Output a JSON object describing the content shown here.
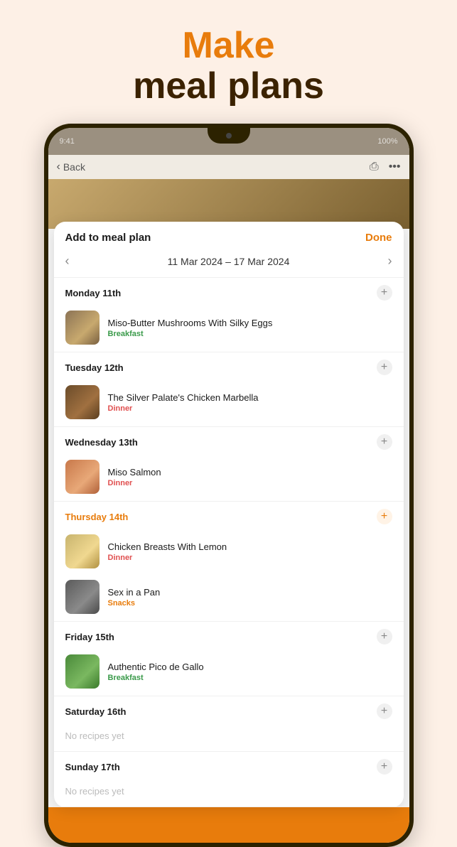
{
  "hero": {
    "make_label": "Make",
    "subtitle_label": "meal plans"
  },
  "device": {
    "top_bar_left": "9:41",
    "top_bar_right": "100%"
  },
  "browser": {
    "back_label": "Back"
  },
  "modal": {
    "title": "Add to meal plan",
    "done_label": "Done",
    "date_range": "11 Mar 2024 – 17 Mar 2024",
    "days": [
      {
        "id": "monday",
        "label": "Monday 11th",
        "highlighted": false,
        "recipes": [
          {
            "name": "Miso-Butter Mushrooms With Silky Eggs",
            "tag": "Breakfast",
            "tag_type": "breakfast",
            "thumb": "mushroom"
          }
        ]
      },
      {
        "id": "tuesday",
        "label": "Tuesday 12th",
        "highlighted": false,
        "recipes": [
          {
            "name": "The Silver Palate's Chicken Marbella",
            "tag": "Dinner",
            "tag_type": "dinner",
            "thumb": "chicken"
          }
        ]
      },
      {
        "id": "wednesday",
        "label": "Wednesday 13th",
        "highlighted": false,
        "recipes": [
          {
            "name": "Miso Salmon",
            "tag": "Dinner",
            "tag_type": "dinner",
            "thumb": "salmon"
          }
        ]
      },
      {
        "id": "thursday",
        "label": "Thursday 14th",
        "highlighted": true,
        "recipes": [
          {
            "name": "Chicken Breasts With Lemon",
            "tag": "Dinner",
            "tag_type": "dinner",
            "thumb": "chicken-lemon"
          },
          {
            "name": "Sex in a Pan",
            "tag": "Snacks",
            "tag_type": "snacks",
            "thumb": "sex-pan"
          }
        ]
      },
      {
        "id": "friday",
        "label": "Friday 15th",
        "highlighted": false,
        "recipes": [
          {
            "name": "Authentic Pico de Gallo",
            "tag": "Breakfast",
            "tag_type": "breakfast",
            "thumb": "pico"
          }
        ]
      },
      {
        "id": "saturday",
        "label": "Saturday 16th",
        "highlighted": false,
        "recipes": []
      },
      {
        "id": "sunday",
        "label": "Sunday 17th",
        "highlighted": false,
        "recipes": []
      }
    ],
    "no_recipes_label": "No recipes yet"
  }
}
